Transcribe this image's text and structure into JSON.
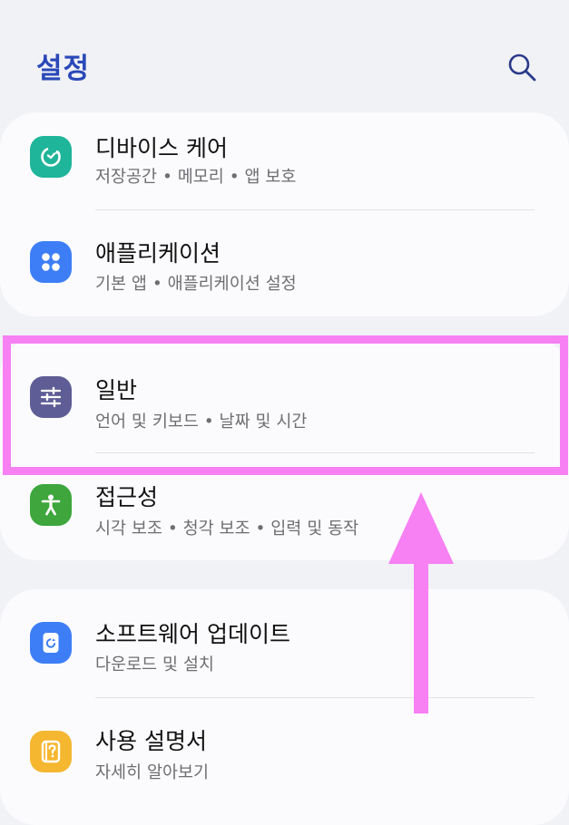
{
  "header": {
    "title": "설정",
    "search_icon": "search-icon"
  },
  "items": [
    {
      "key": "device-care",
      "title": "디바이스 케어",
      "subtitle": "저장공간 • 메모리 • 앱 보호",
      "icon": "device-care-icon",
      "icon_color": "#1fb59a"
    },
    {
      "key": "applications",
      "title": "애플리케이션",
      "subtitle": "기본 앱 • 애플리케이션 설정",
      "icon": "apps-grid-icon",
      "icon_color": "#3d7ef6"
    },
    {
      "key": "general",
      "title": "일반",
      "subtitle": "언어 및 키보드 • 날짜 및 시간",
      "icon": "sliders-icon",
      "icon_color": "#5f5d96"
    },
    {
      "key": "accessibility",
      "title": "접근성",
      "subtitle": "시각 보조 • 청각 보조 • 입력 및 동작",
      "icon": "accessibility-person-icon",
      "icon_color": "#3ea63c"
    },
    {
      "key": "software-update",
      "title": "소프트웨어 업데이트",
      "subtitle": "다운로드 및 설치",
      "icon": "software-update-icon",
      "icon_color": "#3d7ef6"
    },
    {
      "key": "user-manual",
      "title": "사용 설명서",
      "subtitle": "자세히 알아보기",
      "icon": "manual-question-icon",
      "icon_color": "#f5b730"
    }
  ],
  "annotations": {
    "highlight_color": "#f780f3"
  }
}
